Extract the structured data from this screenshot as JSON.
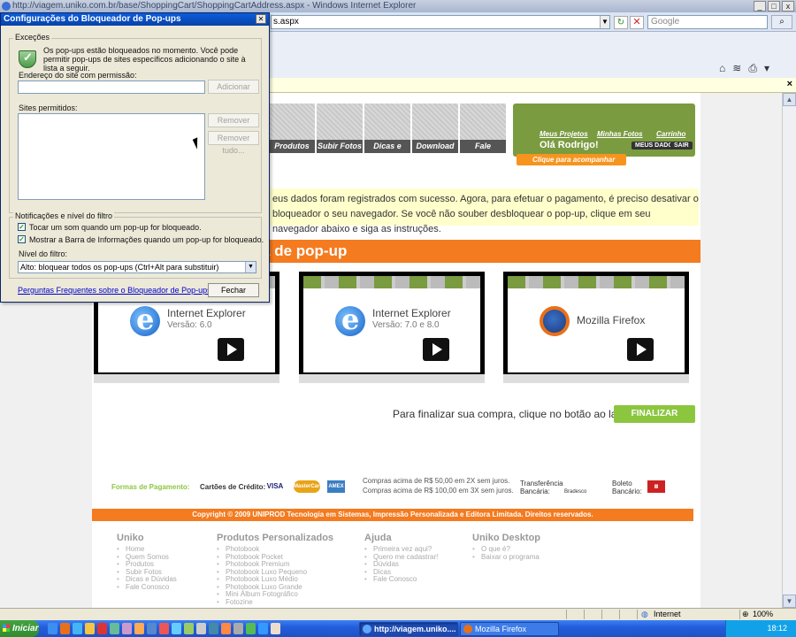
{
  "window": {
    "title": "http://viagem.uniko.com.br/base/ShoppingCart/ShoppingCartAddress.aspx - Windows Internet Explorer",
    "controls": [
      "_",
      "□",
      "x"
    ]
  },
  "address_bar": {
    "url_visible": "s.aspx",
    "search_placeholder": "Google"
  },
  "dialog": {
    "title": "Configurações do Bloqueador de Pop-ups",
    "exceptions_group": "Exceções",
    "exceptions_text": "Os pop-ups estão bloqueados no momento. Você pode permitir pop-ups de sites específicos adicionando o site à lista a seguir.",
    "address_label": "Endereço do site com permissão:",
    "address_value": "",
    "add_button": "Adicionar",
    "allowed_label": "Sites permitidos:",
    "remove_button": "Remover",
    "remove_all_button": "Remover tudo...",
    "notifications_group": "Notificações e nível do filtro",
    "check_sound": "Tocar um som quando um pop-up for bloqueado.",
    "check_infobar": "Mostrar a Barra de Informações quando um pop-up for bloqueado.",
    "filter_label": "Nível do filtro:",
    "filter_value": "Alto: bloquear todos os pop-ups (Ctrl+Alt para substituir)",
    "faq_link": "Perguntas Frequentes sobre o Bloqueador de Pop-ups",
    "close_button": "Fechar"
  },
  "site": {
    "nav": [
      "Produtos",
      "Subir Fotos",
      "Dicas e Dúvidas",
      "Download",
      "Fale Conosco"
    ],
    "user": {
      "projects": "Meus Projetos",
      "photos": "Minhas Fotos",
      "cart": "Carrinho",
      "greeting": "Olá Rodrigo!",
      "my_data": "MEUS DADOS",
      "logout": "SAIR",
      "follow_order": "Clique para acompanhar seu pedido"
    },
    "success_message": "eus dados foram registrados com sucesso. Agora, para efetuar o pagamento, é preciso desativar o bloqueador o seu navegador. Se você não souber desbloquear o pop-up, clique em seu navegador abaixo e siga as instruções.",
    "banner": "anela de pop-up",
    "videos": [
      {
        "browser": "Internet Explorer",
        "version": "Versão: 6.0",
        "icon": "ie"
      },
      {
        "browser": "Internet Explorer",
        "version": "Versão: 7.0 e 8.0",
        "icon": "ie"
      },
      {
        "browser": "Mozilla Firefox",
        "version": "",
        "icon": "ff"
      }
    ],
    "finalize_text": "Para finalizar sua compra, clique no botão ao lado.",
    "finalize_button": "FINALIZAR COMPRA",
    "payment": {
      "label": "Formas de Pagamento:",
      "cards_label": "Cartões de Crédito:",
      "visa": "VISA",
      "mastercard": "MasterCard",
      "amex": "AMEX",
      "installments_1": "Compras acima de R$ 50,00 em 2X sem juros.",
      "installments_2": "Compras acima de R$ 100,00 em 3X sem juros.",
      "transfer": "Transferência Bancária:",
      "bradesco": "Bradesco",
      "boleto": "Boleto Bancário:"
    },
    "copyright": "Copyright © 2009 UNIPROD Tecnologia em Sistemas, Impressão Personalizada e Editora Limitada. Direitos reservados.",
    "footer": [
      {
        "title": "Uniko",
        "items": [
          "Home",
          "Quem Somos",
          "Produtos",
          "Subir Fotos",
          "Dicas e Dúvidas",
          "Fale Conosco"
        ]
      },
      {
        "title": "Produtos Personalizados",
        "items": [
          "Photobook",
          "Photobook Pocket",
          "Photobook Premium",
          "Photobook Luxo Pequeno",
          "Photobook Luxo Médio",
          "Photobook Luxo Grande",
          "Mini Álbum Fotográfico",
          "Fotozine"
        ]
      },
      {
        "title": "Ajuda",
        "items": [
          "Primeira vez aqui?",
          "Quero me cadastrar!",
          "Dúvidas",
          "Dicas",
          "Fale Conosco"
        ]
      },
      {
        "title": "Uniko Desktop",
        "items": [
          "O que é?",
          "Baixar o programa"
        ]
      }
    ]
  },
  "status_bar": {
    "zone": "Internet",
    "zoom": "100%"
  },
  "taskbar": {
    "start": "Iniciar",
    "tasks": [
      "http://viagem.uniko....",
      "Mozilla Firefox"
    ],
    "clock": "18:12"
  }
}
